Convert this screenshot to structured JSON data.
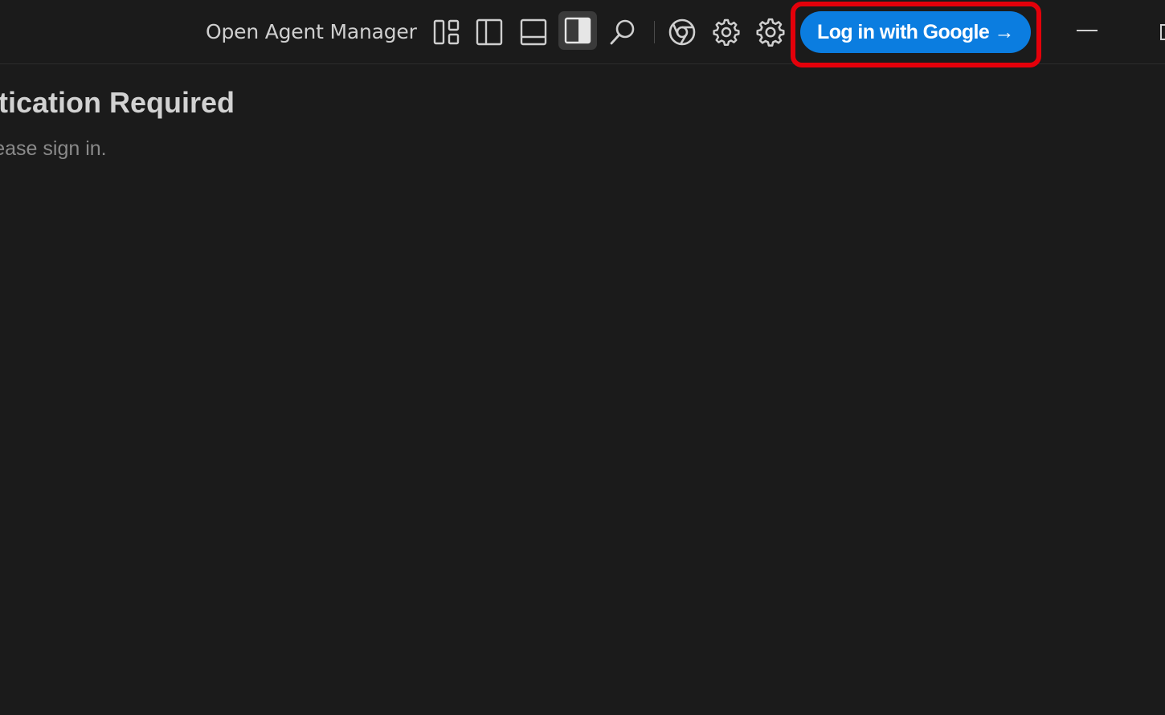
{
  "titlebar": {
    "open_agent_manager_label": "Open Agent Manager",
    "login_button_label": "Log in with Google →",
    "icons": [
      "layout-customize-icon",
      "toggle-primary-sidebar-icon",
      "toggle-panel-icon",
      "toggle-secondary-sidebar-icon",
      "search-icon",
      "chrome-browser-icon",
      "settings-gear-icon",
      "settings-cog-icon"
    ]
  },
  "content": {
    "heading": "Authentication Required",
    "subtext": "Please sign in."
  },
  "colors": {
    "background": "#1b1b1b",
    "accent": "#0b7de0",
    "highlight": "#e4000a"
  }
}
